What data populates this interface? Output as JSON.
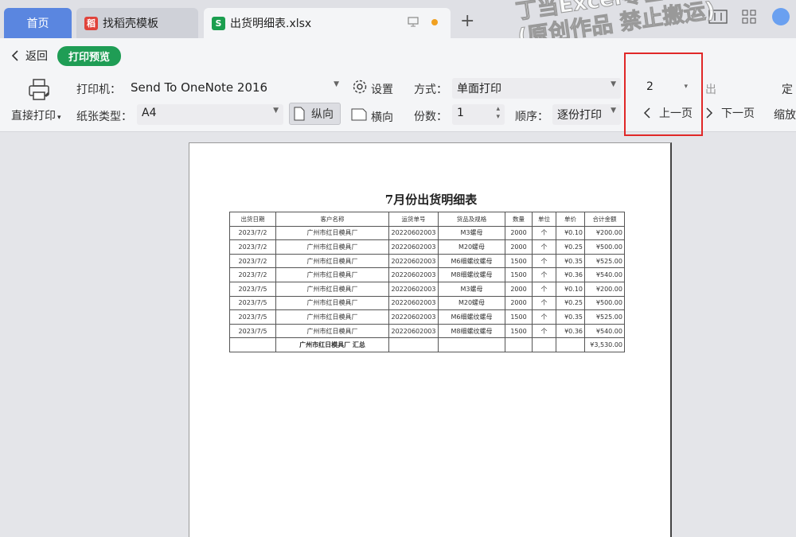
{
  "tabs": {
    "home": "首页",
    "templates": "找稻壳模板",
    "file": "出货明细表.xlsx"
  },
  "toolbar": {
    "back": "返回",
    "preview": "打印预览",
    "direct_print": "直接打印",
    "printer_label": "打印机：",
    "printer_value": "Send To OneNote 2016",
    "settings": "设置",
    "mode_label": "方式：",
    "mode_value": "单面打印",
    "paper_label": "纸张类型：",
    "paper_value": "A4",
    "portrait": "纵向",
    "landscape": "横向",
    "copies_label": "份数：",
    "copies_value": "1",
    "order_label": "顺序：",
    "order_value": "逐份打印",
    "page_value": "2",
    "prev_page": "上一页",
    "next_page": "下一页",
    "zoom": "缩放",
    "partial_1": "出",
    "partial_2": "定"
  },
  "watermark": {
    "line1": "丁当Excel零基础教学",
    "line2": "(原创作品 禁止搬运)"
  },
  "sheet": {
    "title": "7月份出货明细表",
    "headers": [
      "出货日期",
      "客户名称",
      "运货单号",
      "货品及规格",
      "数量",
      "单位",
      "单价",
      "合计金额"
    ],
    "rows": [
      [
        "2023/7/2",
        "广州市红日模具厂",
        "20220602003",
        "M3螺母",
        "2000",
        "个",
        "¥0.10",
        "¥200.00"
      ],
      [
        "2023/7/2",
        "广州市红日模具厂",
        "20220602003",
        "M20螺母",
        "2000",
        "个",
        "¥0.25",
        "¥500.00"
      ],
      [
        "2023/7/2",
        "广州市红日模具厂",
        "20220602003",
        "M6细螺纹螺母",
        "1500",
        "个",
        "¥0.35",
        "¥525.00"
      ],
      [
        "2023/7/2",
        "广州市红日模具厂",
        "20220602003",
        "M8细螺纹螺母",
        "1500",
        "个",
        "¥0.36",
        "¥540.00"
      ],
      [
        "2023/7/5",
        "广州市红日模具厂",
        "20220602003",
        "M3螺母",
        "2000",
        "个",
        "¥0.10",
        "¥200.00"
      ],
      [
        "2023/7/5",
        "广州市红日模具厂",
        "20220602003",
        "M20螺母",
        "2000",
        "个",
        "¥0.25",
        "¥500.00"
      ],
      [
        "2023/7/5",
        "广州市红日模具厂",
        "20220602003",
        "M6细螺纹螺母",
        "1500",
        "个",
        "¥0.35",
        "¥525.00"
      ],
      [
        "2023/7/5",
        "广州市红日模具厂",
        "20220602003",
        "M8细螺纹螺母",
        "1500",
        "个",
        "¥0.36",
        "¥540.00"
      ]
    ],
    "summary_label": "广州市红日模具厂 汇总",
    "summary_total": "¥3,530.00"
  }
}
